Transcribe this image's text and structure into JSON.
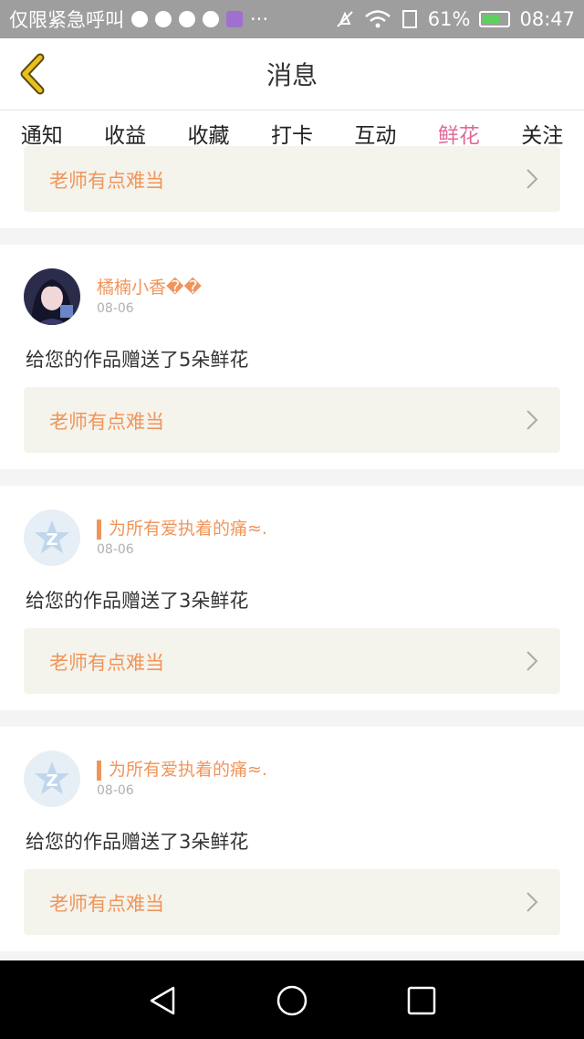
{
  "status_bar": {
    "carrier": "仅限紧急呼叫",
    "more": "···",
    "battery": "61%",
    "time": "08:47"
  },
  "header": {
    "title": "消息"
  },
  "tabs": [
    {
      "label": "通知",
      "active": false
    },
    {
      "label": "收益",
      "active": false
    },
    {
      "label": "收藏",
      "active": false
    },
    {
      "label": "打卡",
      "active": false
    },
    {
      "label": "互动",
      "active": false
    },
    {
      "label": "鲜花",
      "active": true
    },
    {
      "label": "关注",
      "active": false
    }
  ],
  "partial_card": {
    "work_title": "老师有点难当"
  },
  "cards": [
    {
      "username": "橘楠小香��",
      "date": "08-06",
      "message": "给您的作品赠送了5朵鲜花",
      "work_title": "老师有点难当",
      "avatar": "photo-avatar"
    },
    {
      "username": "为所有爱执着的痛≈.",
      "date": "08-06",
      "message": "给您的作品赠送了3朵鲜花",
      "work_title": "老师有点难当",
      "avatar": "qq-default-avatar"
    },
    {
      "username": "为所有爱执着的痛≈.",
      "date": "08-06",
      "message": "给您的作品赠送了3朵鲜花",
      "work_title": "老师有点难当",
      "avatar": "qq-default-avatar"
    }
  ],
  "colors": {
    "accent_pink": "#e06a9a",
    "username_orange": "#f0955a",
    "back_arrow": "#e0b820"
  }
}
